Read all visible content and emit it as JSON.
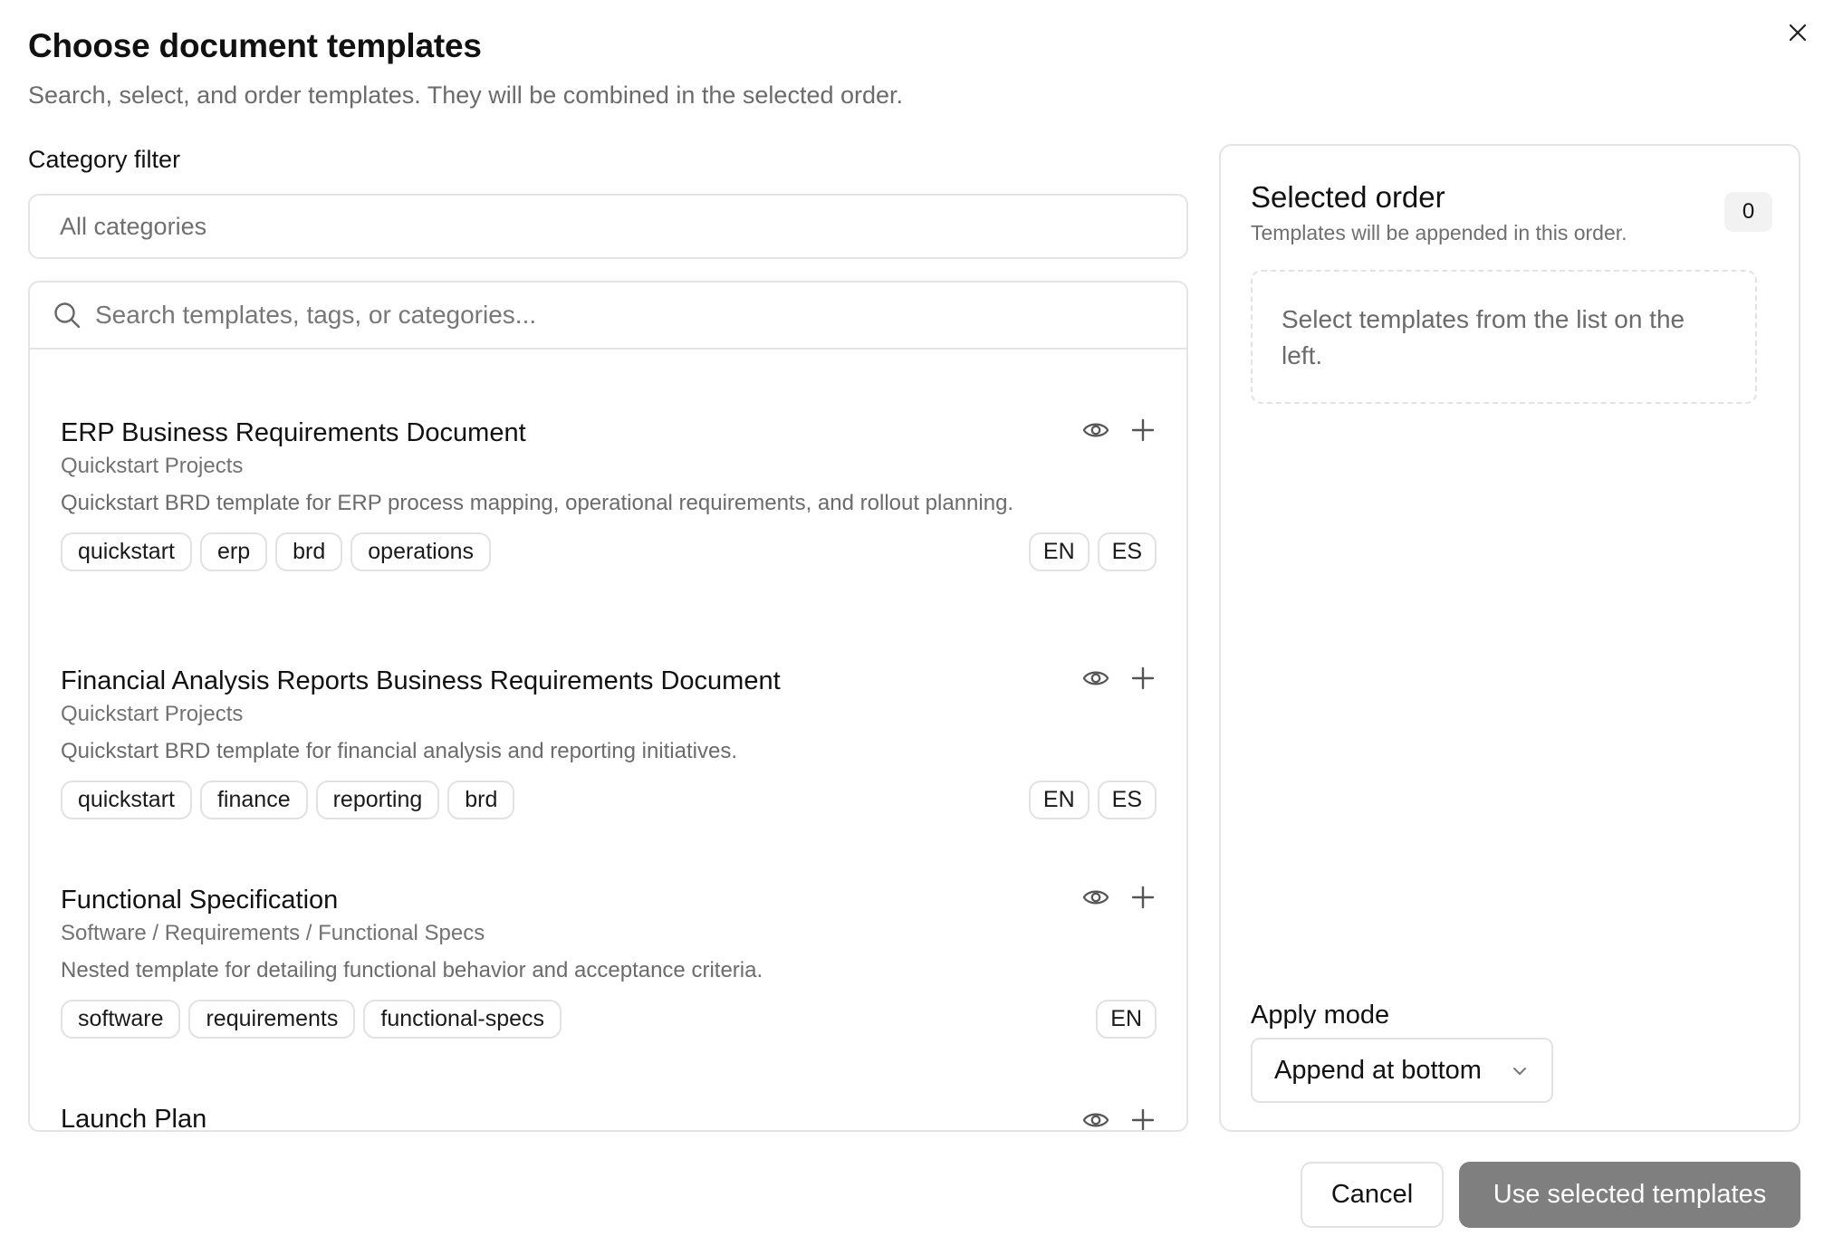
{
  "dialog": {
    "title": "Choose document templates",
    "subtitle": "Search, select, and order templates. They will be combined in the selected order."
  },
  "filter": {
    "label": "Category filter",
    "value": "All categories"
  },
  "search": {
    "placeholder": "Search templates, tags, or categories...",
    "value": ""
  },
  "templates": [
    {
      "title": "ERP Business Requirements Document",
      "category": "Quickstart Projects",
      "description": "Quickstart BRD template for ERP process mapping, operational requirements, and rollout planning.",
      "tags": [
        "quickstart",
        "erp",
        "brd",
        "operations"
      ],
      "languages": [
        "EN",
        "ES"
      ]
    },
    {
      "title": "Financial Analysis Reports Business Requirements Document",
      "category": "Quickstart Projects",
      "description": "Quickstart BRD template for financial analysis and reporting initiatives.",
      "tags": [
        "quickstart",
        "finance",
        "reporting",
        "brd"
      ],
      "languages": [
        "EN",
        "ES"
      ]
    },
    {
      "title": "Functional Specification",
      "category": "Software / Requirements / Functional Specs",
      "description": "Nested template for detailing functional behavior and acceptance criteria.",
      "tags": [
        "software",
        "requirements",
        "functional-specs"
      ],
      "languages": [
        "EN"
      ]
    },
    {
      "title": "Launch Plan"
    }
  ],
  "order": {
    "title": "Selected order",
    "subtitle": "Templates will be appended in this order.",
    "count": "0",
    "empty_text": "Select templates from the list on the left.",
    "apply_mode_label": "Apply mode",
    "apply_mode_value": "Append at bottom"
  },
  "footer": {
    "cancel_label": "Cancel",
    "use_label": "Use selected templates"
  },
  "icons": {
    "close": "close-icon",
    "search": "search-icon",
    "preview": "eye-icon",
    "add": "plus-icon",
    "dropdown": "chevron-down-icon"
  },
  "colors": {
    "primary_disabled": "#7f7f7f",
    "border": "#e4e4e4",
    "muted_text": "#6b6b6b"
  }
}
